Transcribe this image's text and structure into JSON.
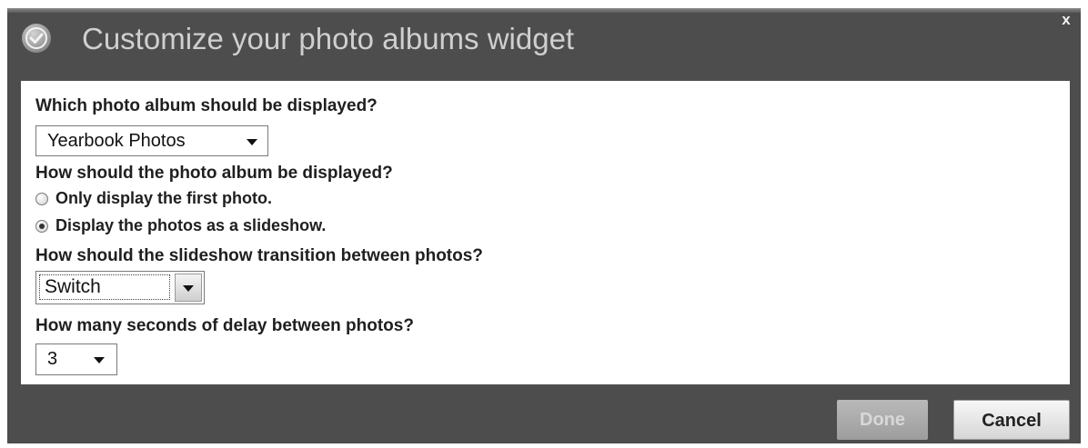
{
  "dialog": {
    "title": "Customize your photo albums widget",
    "close_label": "x"
  },
  "form": {
    "album_question": "Which photo album should be displayed?",
    "album_selected": "Yearbook Photos",
    "display_question": "How should the photo album be displayed?",
    "display_options": [
      {
        "label": "Only display the first photo.",
        "selected": false
      },
      {
        "label": "Display the photos as a slideshow.",
        "selected": true
      }
    ],
    "transition_question": "How should the slideshow transition between photos?",
    "transition_selected": "Switch",
    "delay_question": "How many seconds of delay between photos?",
    "delay_selected": "3"
  },
  "footer": {
    "done_label": "Done",
    "cancel_label": "Cancel"
  },
  "icons": {
    "header_icon": "checkmark-circle-icon",
    "dropdown_icon": "chevron-down-icon"
  }
}
